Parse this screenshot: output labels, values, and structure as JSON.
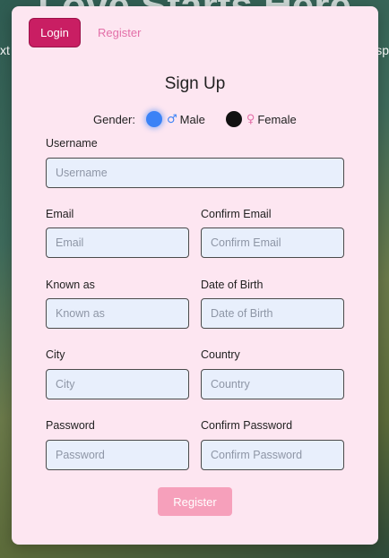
{
  "background": {
    "headline": "Love Starts Here",
    "left_fragment": "xt",
    "right_fragment": "sp"
  },
  "tabs": {
    "login_label": "Login",
    "register_label": "Register"
  },
  "form": {
    "title": "Sign Up",
    "gender_label": "Gender:",
    "gender_options": [
      {
        "symbol": "♂",
        "label": "Male",
        "selected": true
      },
      {
        "symbol": "♀",
        "label": "Female",
        "selected": false
      }
    ],
    "fields": {
      "username": {
        "label": "Username",
        "placeholder": "Username",
        "value": ""
      },
      "email": {
        "label": "Email",
        "placeholder": "Email",
        "value": ""
      },
      "confirm_email": {
        "label": "Confirm Email",
        "placeholder": "Confirm Email",
        "value": ""
      },
      "known_as": {
        "label": "Known as",
        "placeholder": "Known as",
        "value": ""
      },
      "date_of_birth": {
        "label": "Date of Birth",
        "placeholder": "Date of Birth",
        "value": ""
      },
      "city": {
        "label": "City",
        "placeholder": "City",
        "value": ""
      },
      "country": {
        "label": "Country",
        "placeholder": "Country",
        "value": ""
      },
      "password": {
        "label": "Password",
        "placeholder": "Password",
        "value": ""
      },
      "confirm_password": {
        "label": "Confirm Password",
        "placeholder": "Confirm Password",
        "value": ""
      }
    },
    "submit_label": "Register"
  },
  "colors": {
    "accent": "#c91e63",
    "link": "#e36fa8",
    "card": "#fde6f1",
    "input_bg": "#e8effc",
    "submit_disabled": "#f6a0bb",
    "male_radio": "#3b82f6"
  }
}
